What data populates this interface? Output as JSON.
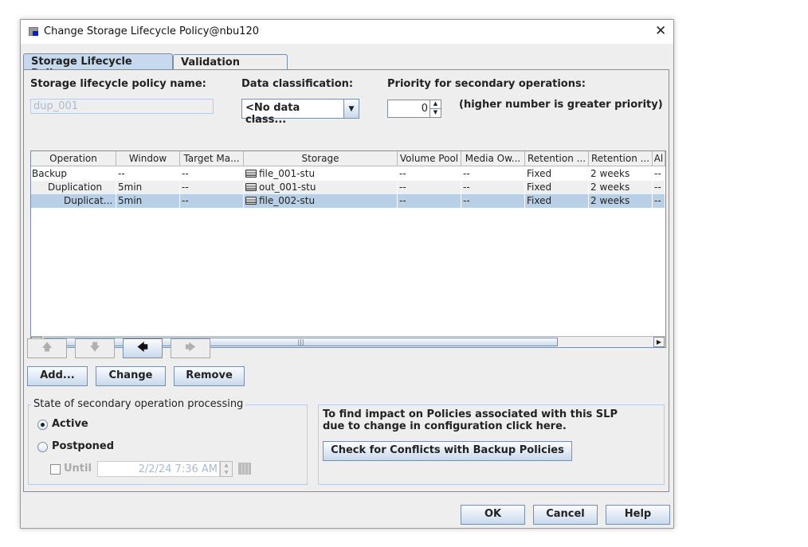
{
  "window": {
    "title": "Change Storage Lifecycle Policy@nbu120",
    "icons": [
      "app-icon",
      "close-icon"
    ]
  },
  "tabs": [
    {
      "label": "Storage Lifecycle Policy",
      "active": true
    },
    {
      "label": "Validation Report",
      "active": false
    }
  ],
  "form": {
    "name_label": "Storage lifecycle policy name:",
    "name_value": "dup_001",
    "classification_label": "Data classification:",
    "classification_value": "<No data class...",
    "priority_label": "Priority for secondary operations:",
    "priority_value": "0",
    "priority_hint": "(higher number is greater priority)"
  },
  "table": {
    "columns": [
      "Operation",
      "Window",
      "Target Ma...",
      "Storage",
      "Volume Pool",
      "Media Ow...",
      "Retention ...",
      "Retention ...",
      "Al"
    ],
    "rows": [
      {
        "cells": [
          "Backup",
          "--",
          "--",
          "file_001-stu",
          "--",
          "--",
          "Fixed",
          "2 weeks",
          "--"
        ],
        "selected": false
      },
      {
        "cells": [
          "Duplication",
          "5min",
          "--",
          "out_001-stu",
          "--",
          "--",
          "Fixed",
          "2 weeks",
          "--"
        ],
        "selected": false
      },
      {
        "cells": [
          "Duplicat...",
          "5min",
          "--",
          "file_002-stu",
          "--",
          "--",
          "Fixed",
          "2 weeks",
          "--"
        ],
        "selected": true
      }
    ]
  },
  "arrows": [
    {
      "icon": "arrow-up-icon",
      "glyph": "🡅",
      "enabled": false
    },
    {
      "icon": "arrow-down-icon",
      "glyph": "🡇",
      "enabled": false
    },
    {
      "icon": "arrow-left-icon",
      "glyph": "🡄",
      "enabled": true
    },
    {
      "icon": "arrow-right-icon",
      "glyph": "🡆",
      "enabled": false
    }
  ],
  "actions": {
    "add": "Add...",
    "change": "Change",
    "remove": "Remove"
  },
  "state": {
    "legend": "State of secondary operation processing",
    "active": "Active",
    "postponed": "Postponed",
    "until": "Until",
    "until_value": "2/2/24 7:36 AM",
    "selected": "Active"
  },
  "conflicts": {
    "text1": "To find impact on Policies associated with this SLP",
    "text2": "due to change in configuration click here.",
    "button": "Check for Conflicts with Backup Policies"
  },
  "footer": {
    "ok": "OK",
    "cancel": "Cancel",
    "help": "Help"
  },
  "colors": {
    "selection": "#b8cfe5",
    "accent": "#7a8ea8"
  }
}
